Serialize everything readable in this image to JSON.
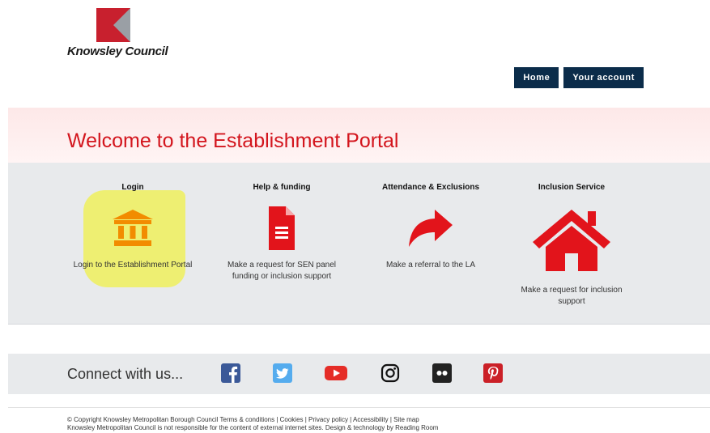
{
  "brand": {
    "name": "Knowsley Council",
    "colors": {
      "red": "#c8202e",
      "grey": "#9a9fa5"
    }
  },
  "nav": {
    "home": "Home",
    "account": "Your account"
  },
  "hero": {
    "title": "Welcome to the Establishment Portal"
  },
  "services": [
    {
      "title": "Login",
      "desc": "Login to the Establishment Portal",
      "icon": "bank-icon",
      "color": "#f28c00"
    },
    {
      "title": "Help & funding",
      "desc": "Make a request for SEN panel funding or inclusion support",
      "icon": "document-icon",
      "color": "#e2141b"
    },
    {
      "title": "Attendance & Exclusions",
      "desc": "Make a referral to the LA",
      "icon": "share-arrow-icon",
      "color": "#e2141b"
    },
    {
      "title": "Inclusion Service",
      "desc": "Make a request for inclusion support",
      "icon": "house-icon",
      "color": "#e2141b"
    }
  ],
  "connect": {
    "label": "Connect with us...",
    "networks": [
      "facebook-icon",
      "twitter-icon",
      "youtube-icon",
      "instagram-icon",
      "flickr-icon",
      "pinterest-icon"
    ]
  },
  "footer": {
    "line1": "© Copyright Knowsley Metropolitan Borough Council Terms & conditions | Cookies | Privacy policy | Accessibility | Site map",
    "line2": "Knowsley Metropolitan Council is not responsible for the content of external internet sites. Design & technology by Reading Room"
  }
}
